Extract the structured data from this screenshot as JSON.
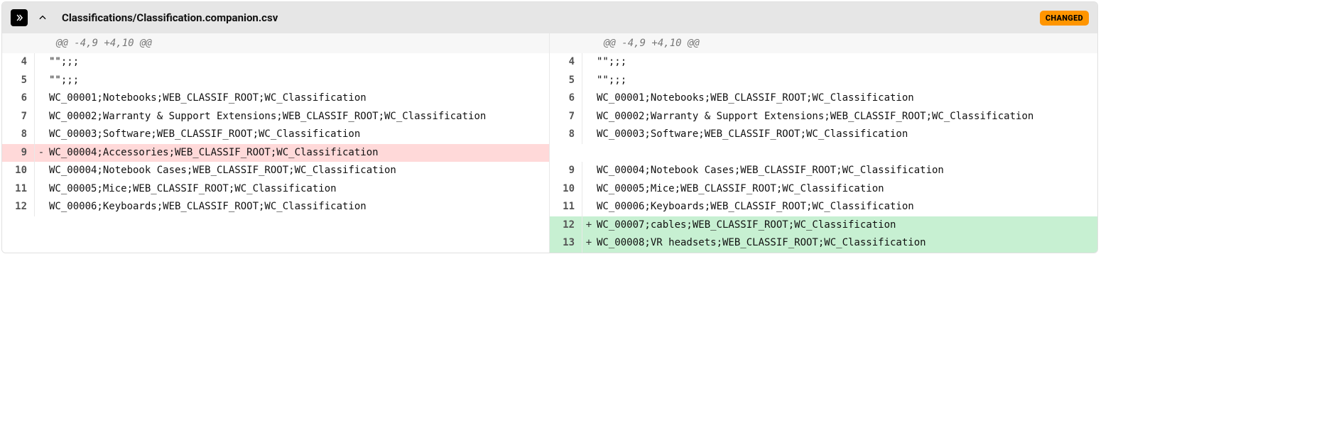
{
  "header": {
    "file_path": "Classifications/Classification.companion.csv",
    "badge": "CHANGED"
  },
  "hunk": {
    "left": "@@ -4,9 +4,10 @@",
    "right": "@@ -4,9 +4,10 @@"
  },
  "left_rows": [
    {
      "ln": "4",
      "type": "ctx",
      "marker": "",
      "code": "\"\";;;"
    },
    {
      "ln": "5",
      "type": "ctx",
      "marker": "",
      "code": "\"\";;;"
    },
    {
      "ln": "6",
      "type": "ctx",
      "marker": "",
      "code": "WC_00001;Notebooks;WEB_CLASSIF_ROOT;WC_Classification"
    },
    {
      "ln": "7",
      "type": "ctx",
      "marker": "",
      "code": "WC_00002;Warranty & Support Extensions;WEB_CLASSIF_ROOT;WC_Classification"
    },
    {
      "ln": "8",
      "type": "ctx",
      "marker": "",
      "code": "WC_00003;Software;WEB_CLASSIF_ROOT;WC_Classification"
    },
    {
      "ln": "9",
      "type": "removed",
      "marker": "-",
      "code": "WC_00004;Accessories;WEB_CLASSIF_ROOT;WC_Classification"
    },
    {
      "ln": "10",
      "type": "ctx",
      "marker": "",
      "code": "WC_00004;Notebook Cases;WEB_CLASSIF_ROOT;WC_Classification"
    },
    {
      "ln": "11",
      "type": "ctx",
      "marker": "",
      "code": "WC_00005;Mice;WEB_CLASSIF_ROOT;WC_Classification"
    },
    {
      "ln": "12",
      "type": "ctx",
      "marker": "",
      "code": "WC_00006;Keyboards;WEB_CLASSIF_ROOT;WC_Classification"
    },
    {
      "ln": "",
      "type": "empty",
      "marker": "",
      "code": ""
    },
    {
      "ln": "",
      "type": "empty",
      "marker": "",
      "code": ""
    }
  ],
  "right_rows": [
    {
      "ln": "4",
      "type": "ctx",
      "marker": "",
      "code": "\"\";;;"
    },
    {
      "ln": "5",
      "type": "ctx",
      "marker": "",
      "code": "\"\";;;"
    },
    {
      "ln": "6",
      "type": "ctx",
      "marker": "",
      "code": "WC_00001;Notebooks;WEB_CLASSIF_ROOT;WC_Classification"
    },
    {
      "ln": "7",
      "type": "ctx",
      "marker": "",
      "code": "WC_00002;Warranty & Support Extensions;WEB_CLASSIF_ROOT;WC_Classification"
    },
    {
      "ln": "8",
      "type": "ctx",
      "marker": "",
      "code": "WC_00003;Software;WEB_CLASSIF_ROOT;WC_Classification"
    },
    {
      "ln": "",
      "type": "empty",
      "marker": "",
      "code": ""
    },
    {
      "ln": "9",
      "type": "ctx",
      "marker": "",
      "code": "WC_00004;Notebook Cases;WEB_CLASSIF_ROOT;WC_Classification"
    },
    {
      "ln": "10",
      "type": "ctx",
      "marker": "",
      "code": "WC_00005;Mice;WEB_CLASSIF_ROOT;WC_Classification"
    },
    {
      "ln": "11",
      "type": "ctx",
      "marker": "",
      "code": "WC_00006;Keyboards;WEB_CLASSIF_ROOT;WC_Classification"
    },
    {
      "ln": "12",
      "type": "added",
      "marker": "+",
      "code": "WC_00007;cables;WEB_CLASSIF_ROOT;WC_Classification"
    },
    {
      "ln": "13",
      "type": "added",
      "marker": "+",
      "code": "WC_00008;VR headsets;WEB_CLASSIF_ROOT;WC_Classification"
    }
  ]
}
